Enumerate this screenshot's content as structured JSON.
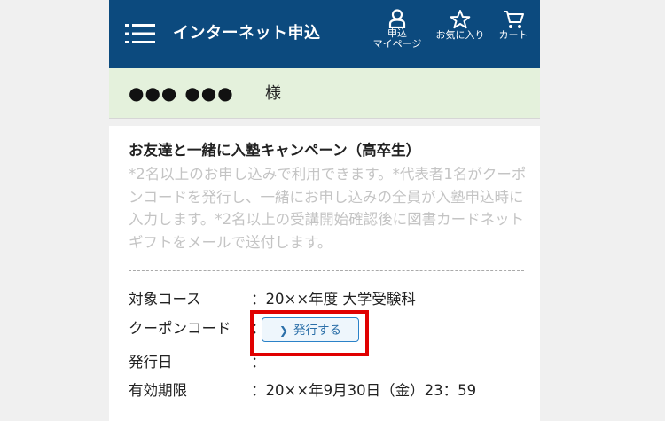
{
  "header": {
    "title": "インターネット申込",
    "mypage_line1": "申込",
    "mypage_line2": "マイページ",
    "favorites_label": "お気に入り",
    "cart_label": "カート",
    "background_color": "#0c4a7e"
  },
  "greeting": {
    "user_name": "●●● ●●●",
    "honorific": "様",
    "background_color": "#e4f1dc"
  },
  "campaign": {
    "title": "お友達と一緒に入塾キャンペーン（高卒生）",
    "description": "*2名以上のお申し込みで利用できます。*代表者1名がクーポンコードを発行し、一緒にお申し込みの全員が入塾申込時に入力します。*2名以上の受講開始確認後に図書カードネットギフトをメールで送付します。",
    "rows": {
      "course_label": "対象コース",
      "course_value": "：20××年度 大学受験科",
      "coupon_label": "クーポンコード",
      "coupon_colon": "：",
      "issue_button_label": "発行する",
      "issue_date_label": "発行日",
      "issue_date_value": "：",
      "expiry_label": "有効期限",
      "expiry_value": "：20××年9月30日（金）23：59"
    }
  },
  "highlight_color": "#e00000"
}
